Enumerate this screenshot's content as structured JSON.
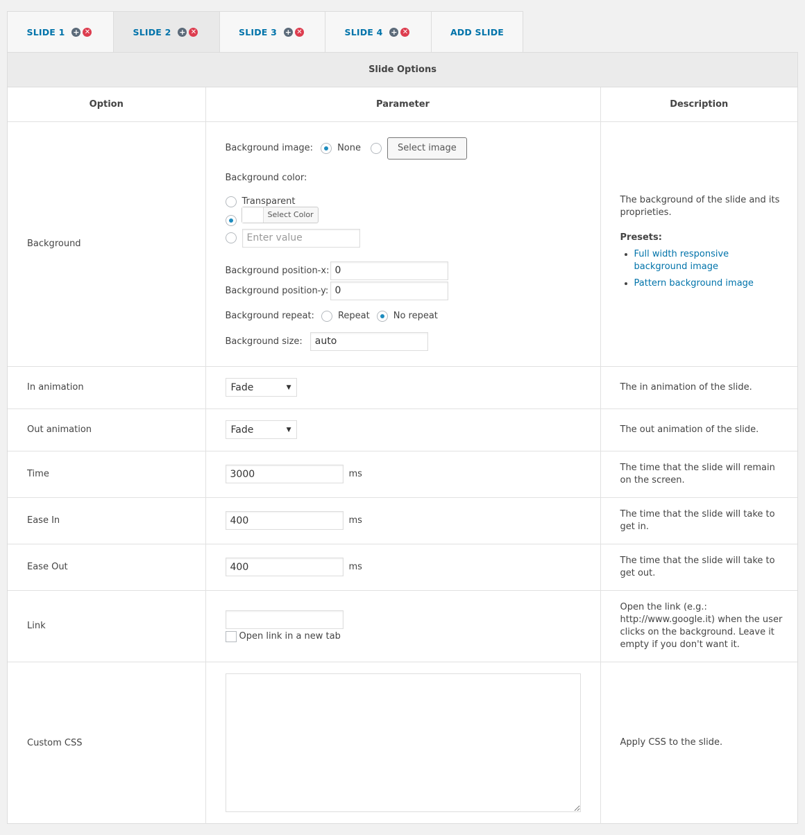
{
  "tabs": [
    {
      "label": "SLIDE 1",
      "has_controls": true,
      "active": false
    },
    {
      "label": "SLIDE 2",
      "has_controls": true,
      "active": true
    },
    {
      "label": "SLIDE 3",
      "has_controls": true,
      "active": false
    },
    {
      "label": "SLIDE 4",
      "has_controls": true,
      "active": false
    },
    {
      "label": "ADD SLIDE",
      "has_controls": false,
      "active": false
    }
  ],
  "panel": {
    "title": "Slide Options"
  },
  "columns": {
    "option": "Option",
    "parameter": "Parameter",
    "description": "Description"
  },
  "background": {
    "label": "Background",
    "image_label": "Background image:",
    "none_label": "None",
    "select_image": "Select image",
    "color_label": "Background color:",
    "transparent_label": "Transparent",
    "select_color": "Select Color",
    "enter_value_placeholder": "Enter value",
    "posx_label": "Background position-x:",
    "posx_value": "0",
    "posy_label": "Background position-y:",
    "posy_value": "0",
    "repeat_label": "Background repeat:",
    "repeat_option": "Repeat",
    "norepeat_option": "No repeat",
    "size_label": "Background size:",
    "size_value": "auto",
    "desc": "The background of the slide and its proprieties.",
    "presets_label": "Presets:",
    "preset_1": "Full width responsive background image",
    "preset_2": "Pattern background image"
  },
  "in_animation": {
    "label": "In animation",
    "value": "Fade",
    "desc": "The in animation of the slide."
  },
  "out_animation": {
    "label": "Out animation",
    "value": "Fade",
    "desc": "The out animation of the slide."
  },
  "time": {
    "label": "Time",
    "value": "3000",
    "unit": "ms",
    "desc": "The time that the slide will remain on the screen."
  },
  "ease_in": {
    "label": "Ease In",
    "value": "400",
    "unit": "ms",
    "desc": "The time that the slide will take to get in."
  },
  "ease_out": {
    "label": "Ease Out",
    "value": "400",
    "unit": "ms",
    "desc": "The time that the slide will take to get out."
  },
  "link": {
    "label": "Link",
    "value": "",
    "newtab_label": "Open link in a new tab",
    "desc": "Open the link (e.g.: http://www.google.it) when the user clicks on the background. Leave it empty if you don't want it."
  },
  "custom_css": {
    "label": "Custom CSS",
    "value": "",
    "desc": "Apply CSS to the slide."
  },
  "colors": {
    "link": "#0073aa",
    "radio_selected": "#1e8cbe",
    "delete_icon": "#dd3d4f",
    "add_icon": "#5b6a79"
  }
}
